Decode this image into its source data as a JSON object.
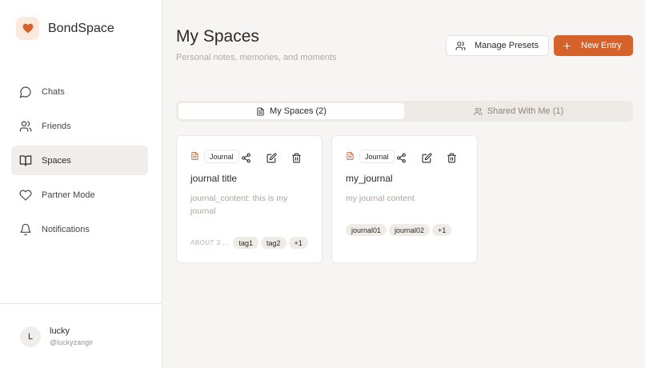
{
  "brand": {
    "name": "BondSpace",
    "logo_icon": "heart-icon",
    "accent": "#d4622a"
  },
  "sidebar": {
    "items": [
      {
        "label": "Chats",
        "icon": "chat-bubble-icon",
        "active": false
      },
      {
        "label": "Friends",
        "icon": "users-icon",
        "active": false
      },
      {
        "label": "Spaces",
        "icon": "book-open-icon",
        "active": true
      },
      {
        "label": "Partner Mode",
        "icon": "heart-outline-icon",
        "active": false
      },
      {
        "label": "Notifications",
        "icon": "bell-icon",
        "active": false
      }
    ]
  },
  "user": {
    "initial": "L",
    "name": "lucky",
    "handle": "@luckyzangir"
  },
  "header": {
    "title": "My Spaces",
    "subtitle": "Personal notes, memories, and moments",
    "manage_presets_label": "Manage Presets",
    "new_entry_label": "New Entry"
  },
  "tabs": [
    {
      "label": "My Spaces (2)",
      "active": true
    },
    {
      "label": "Shared With Me (1)",
      "active": false
    }
  ],
  "cards": [
    {
      "badge": "Journal",
      "title": "journal title",
      "content": "journal_content: this is my journal",
      "about": "ABOUT 3 ...",
      "tags": [
        "tag1",
        "tag2",
        "+1"
      ]
    },
    {
      "badge": "Journal",
      "title": "my_journal",
      "content": "my journal content",
      "about": "",
      "tags": [
        "journal01",
        "journal02",
        "+1"
      ]
    }
  ]
}
